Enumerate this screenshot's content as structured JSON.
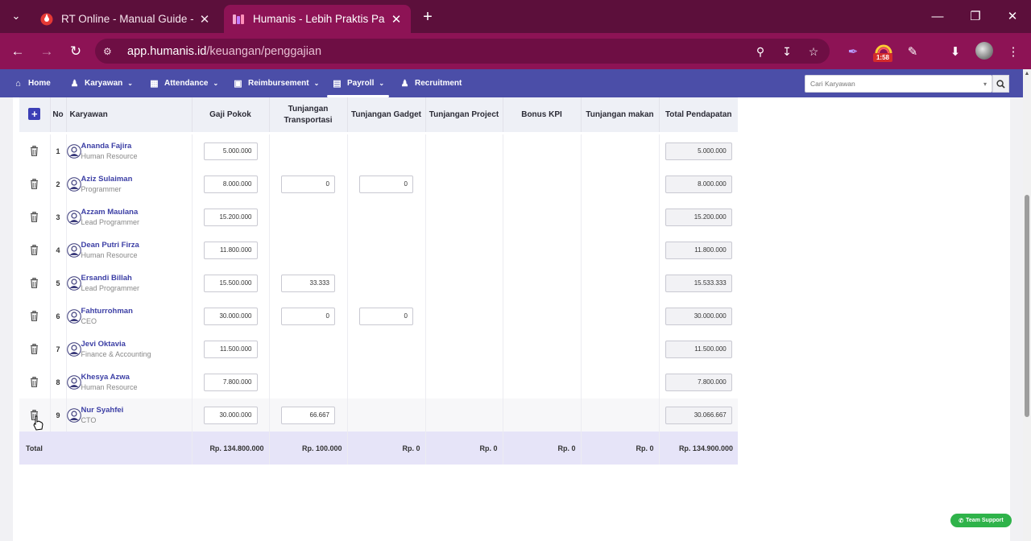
{
  "browser": {
    "tabs": [
      {
        "title": "RT Online - Manual Guide - Xm",
        "active": false
      },
      {
        "title": "Humanis - Lebih Praktis Pakai H",
        "active": true
      }
    ],
    "url_host": "app.humanis.id",
    "url_path": "/keuangan/penggajian",
    "timer_badge": "1:58"
  },
  "nav": {
    "items": [
      {
        "label": "Home",
        "icon": "home-icon"
      },
      {
        "label": "Karyawan",
        "icon": "user-edit-icon"
      },
      {
        "label": "Attendance",
        "icon": "calendar-icon"
      },
      {
        "label": "Reimbursement",
        "icon": "money-icon"
      },
      {
        "label": "Payroll",
        "icon": "payroll-icon"
      },
      {
        "label": "Recruitment",
        "icon": "users-icon"
      }
    ],
    "search_placeholder": "Cari Karyawan"
  },
  "table": {
    "headers": {
      "no": "No",
      "karyawan": "Karyawan",
      "gaji_pokok": "Gaji Pokok",
      "transport": "Tunjangan Transportasi",
      "gadget": "Tunjangan Gadget",
      "project": "Tunjangan Project",
      "bonus": "Bonus KPI",
      "makan": "Tunjangan makan",
      "total": "Total Pendapatan"
    },
    "rows": [
      {
        "no": "1",
        "name": "Ananda Fajira",
        "role": "Human Resource",
        "gaji": "5.000.000",
        "transport": null,
        "gadget": null,
        "total": "5.000.000"
      },
      {
        "no": "2",
        "name": "Aziz Sulaiman",
        "role": "Programmer",
        "gaji": "8.000.000",
        "transport": "0",
        "gadget": "0",
        "total": "8.000.000"
      },
      {
        "no": "3",
        "name": "Azzam Maulana",
        "role": "Lead Programmer",
        "gaji": "15.200.000",
        "transport": null,
        "gadget": null,
        "total": "15.200.000"
      },
      {
        "no": "4",
        "name": "Dean Putri Firza",
        "role": "Human Resource",
        "gaji": "11.800.000",
        "transport": null,
        "gadget": null,
        "total": "11.800.000"
      },
      {
        "no": "5",
        "name": "Ersandi Billah",
        "role": "Lead Programmer",
        "gaji": "15.500.000",
        "transport": "33.333",
        "gadget": null,
        "total": "15.533.333"
      },
      {
        "no": "6",
        "name": "Fahturrohman",
        "role": "CEO",
        "gaji": "30.000.000",
        "transport": "0",
        "gadget": "0",
        "total": "30.000.000"
      },
      {
        "no": "7",
        "name": "Jevi Oktavia",
        "role": "Finance & Accounting",
        "gaji": "11.500.000",
        "transport": null,
        "gadget": null,
        "total": "11.500.000"
      },
      {
        "no": "8",
        "name": "Khesya Azwa",
        "role": "Human Resource",
        "gaji": "7.800.000",
        "transport": null,
        "gadget": null,
        "total": "7.800.000"
      },
      {
        "no": "9",
        "name": "Nur Syahfei",
        "role": "CTO",
        "gaji": "30.000.000",
        "transport": "66.667",
        "gadget": null,
        "total": "30.066.667"
      }
    ],
    "totals": {
      "label": "Total",
      "gaji": "Rp. 134.800.000",
      "transport": "Rp. 100.000",
      "gadget": "Rp. 0",
      "project": "Rp. 0",
      "bonus": "Rp. 0",
      "makan": "Rp. 0",
      "total": "Rp. 134.900.000"
    }
  },
  "support_button": "Team Support",
  "colors": {
    "chrome_dark": "#5c0f3b",
    "chrome": "#8d1355",
    "nav": "#4b4ea8",
    "accent": "#3c3fb6",
    "total_row": "#e6e4f8",
    "support": "#2fb34a"
  }
}
